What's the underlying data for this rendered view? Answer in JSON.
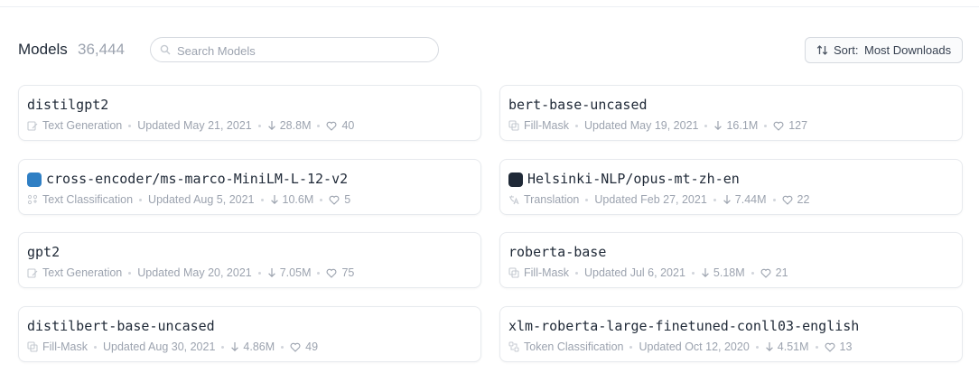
{
  "header": {
    "title": "Models",
    "count": "36,444",
    "search_placeholder": "Search Models",
    "sort_label": "Sort:",
    "sort_value": "Most Downloads"
  },
  "models": [
    {
      "name": "distilgpt2",
      "task": "Text Generation",
      "task_icon": "text-generation-icon",
      "updated": "Updated May 21, 2021",
      "downloads": "28.8M",
      "likes": "40",
      "avatar": null
    },
    {
      "name": "bert-base-uncased",
      "task": "Fill-Mask",
      "task_icon": "fill-mask-icon",
      "updated": "Updated May 19, 2021",
      "downloads": "16.1M",
      "likes": "127",
      "avatar": null
    },
    {
      "name": "cross-encoder/ms-marco-MiniLM-L-12-v2",
      "task": "Text Classification",
      "task_icon": "text-classification-icon",
      "updated": "Updated Aug 5, 2021",
      "downloads": "10.6M",
      "likes": "5",
      "avatar": "org-avatar-blue",
      "avatar_color": "#2f7fc4"
    },
    {
      "name": "Helsinki-NLP/opus-mt-zh-en",
      "task": "Translation",
      "task_icon": "translation-icon",
      "updated": "Updated Feb 27, 2021",
      "downloads": "7.44M",
      "likes": "22",
      "avatar": "org-avatar-dark",
      "avatar_color": "#1f2937"
    },
    {
      "name": "gpt2",
      "task": "Text Generation",
      "task_icon": "text-generation-icon",
      "updated": "Updated May 20, 2021",
      "downloads": "7.05M",
      "likes": "75",
      "avatar": null
    },
    {
      "name": "roberta-base",
      "task": "Fill-Mask",
      "task_icon": "fill-mask-icon",
      "updated": "Updated Jul 6, 2021",
      "downloads": "5.18M",
      "likes": "21",
      "avatar": null
    },
    {
      "name": "distilbert-base-uncased",
      "task": "Fill-Mask",
      "task_icon": "fill-mask-icon",
      "updated": "Updated Aug 30, 2021",
      "downloads": "4.86M",
      "likes": "49",
      "avatar": null
    },
    {
      "name": "xlm-roberta-large-finetuned-conll03-english",
      "task": "Token Classification",
      "task_icon": "token-classification-icon",
      "updated": "Updated Oct 12, 2020",
      "downloads": "4.51M",
      "likes": "13",
      "avatar": null
    }
  ],
  "colors": {
    "text": "#1f2937",
    "muted": "#9ca3af",
    "border": "#e7eaee"
  }
}
